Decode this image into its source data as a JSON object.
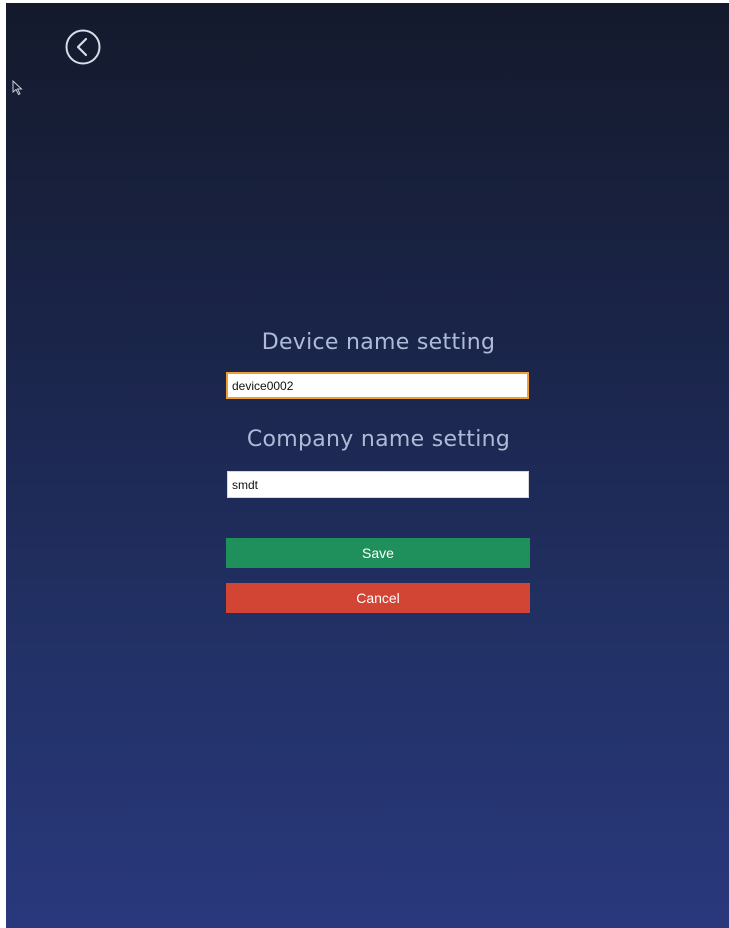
{
  "icons": {
    "back": "back-arrow-circle-icon",
    "cursor": "mouse-pointer-icon"
  },
  "form": {
    "device_title": "Device name setting",
    "device_value": "device0002",
    "company_title": "Company name setting",
    "company_value": "smdt",
    "save_label": "Save",
    "cancel_label": "Cancel"
  },
  "colors": {
    "background_top": "#141a2c",
    "background_bottom": "#29387c",
    "title_text": "#aebbd6",
    "focus_border": "#f0a030",
    "save": "#1f8f5c",
    "cancel": "#d24434"
  }
}
